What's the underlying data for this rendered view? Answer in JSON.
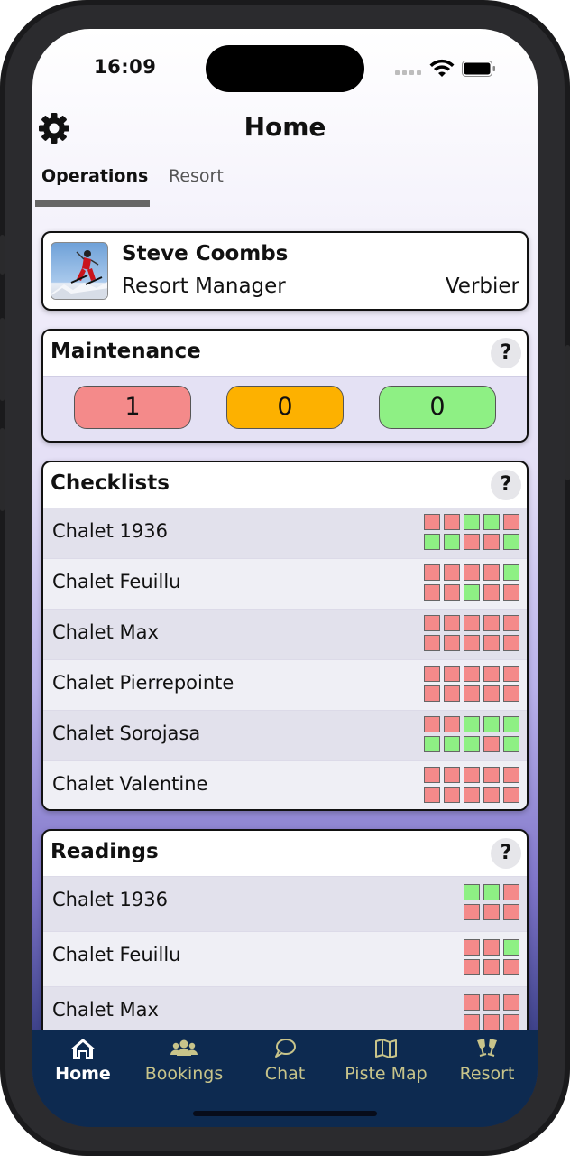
{
  "status_bar": {
    "time": "16:09"
  },
  "header": {
    "title": "Home",
    "settings_icon": "gear-icon"
  },
  "tabs": [
    {
      "label": "Operations",
      "active": true
    },
    {
      "label": "Resort",
      "active": false
    }
  ],
  "profile": {
    "name": "Steve Coombs",
    "role": "Resort Manager",
    "resort": "Verbier"
  },
  "maintenance": {
    "title": "Maintenance",
    "help": "?",
    "counts": [
      {
        "value": "1",
        "color": "#f48a8a"
      },
      {
        "value": "0",
        "color": "#fdb100"
      },
      {
        "value": "0",
        "color": "#8ef084"
      }
    ]
  },
  "checklists": {
    "title": "Checklists",
    "help": "?",
    "rows": [
      {
        "name": "Chalet 1936",
        "status": [
          "r",
          "r",
          "g",
          "g",
          "r",
          "g",
          "g",
          "r",
          "r",
          "g"
        ]
      },
      {
        "name": "Chalet Feuillu",
        "status": [
          "r",
          "r",
          "r",
          "r",
          "g",
          "r",
          "r",
          "g",
          "r",
          "r"
        ]
      },
      {
        "name": "Chalet Max",
        "status": [
          "r",
          "r",
          "r",
          "r",
          "r",
          "r",
          "r",
          "r",
          "r",
          "r"
        ]
      },
      {
        "name": "Chalet Pierrepointe",
        "status": [
          "r",
          "r",
          "r",
          "r",
          "r",
          "r",
          "r",
          "r",
          "r",
          "r"
        ]
      },
      {
        "name": "Chalet Sorojasa",
        "status": [
          "r",
          "r",
          "g",
          "g",
          "g",
          "g",
          "g",
          "g",
          "r",
          "g"
        ]
      },
      {
        "name": "Chalet Valentine",
        "status": [
          "r",
          "r",
          "r",
          "r",
          "r",
          "r",
          "r",
          "r",
          "r",
          "r"
        ]
      }
    ]
  },
  "readings": {
    "title": "Readings",
    "help": "?",
    "rows": [
      {
        "name": "Chalet 1936",
        "status": [
          "g",
          "g",
          "r",
          "r",
          "r",
          "r"
        ]
      },
      {
        "name": "Chalet Feuillu",
        "status": [
          "r",
          "r",
          "g",
          "r",
          "r",
          "r"
        ]
      },
      {
        "name": "Chalet Max",
        "status": [
          "r",
          "r",
          "r",
          "r",
          "r",
          "r"
        ]
      }
    ]
  },
  "status_colors": {
    "r": "#f48a8a",
    "g": "#8ef084"
  },
  "tabbar": {
    "items": [
      {
        "label": "Home",
        "icon": "home-icon",
        "active": true
      },
      {
        "label": "Bookings",
        "icon": "users-icon",
        "active": false
      },
      {
        "label": "Chat",
        "icon": "chat-bubble-icon",
        "active": false
      },
      {
        "label": "Piste Map",
        "icon": "map-icon",
        "active": false
      },
      {
        "label": "Resort",
        "icon": "champagne-glasses-icon",
        "active": false
      }
    ]
  }
}
